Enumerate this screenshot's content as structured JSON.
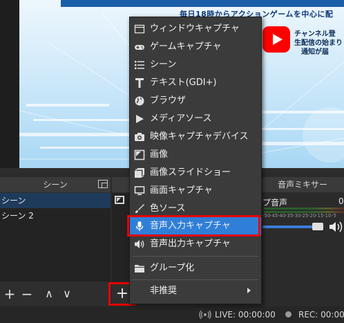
{
  "preview": {
    "subtitle": "毎日18時からアクションゲームを中心に配",
    "promo_lines": [
      "チャンネル登",
      "生配信の始まり",
      "通知が届"
    ],
    "colors": {
      "youtube": "#ff0000",
      "sky": "#cfe9fa"
    }
  },
  "scenes": {
    "title": "シーン",
    "items": [
      "シーン",
      "シーン 2"
    ],
    "selected_index": 0,
    "toolbar": {
      "add": "+",
      "remove": "−",
      "up": "∧",
      "down": "∨"
    }
  },
  "sources": {
    "add_button": "+"
  },
  "mixer": {
    "title": "音声ミキサー",
    "track_name": "プ音声",
    "db_value": "0",
    "scale": [
      "-50",
      "-45",
      "-40",
      "-35",
      "-30",
      "-25",
      "-20",
      "-15",
      "-10",
      "-5"
    ],
    "volume_level": 0.95
  },
  "statusbar": {
    "live": "LIVE: 00:00:00",
    "rec": "REC: 00:00:"
  },
  "context_menu": {
    "items": [
      {
        "label": "ウィンドウキャプチャ",
        "icon": "window-icon"
      },
      {
        "label": "ゲームキャプチャ",
        "icon": "gamepad-icon"
      },
      {
        "label": "シーン",
        "icon": "list-icon"
      },
      {
        "label": "テキスト(GDI+)",
        "icon": "text-icon"
      },
      {
        "label": "ブラウザ",
        "icon": "globe-icon"
      },
      {
        "label": "メディアソース",
        "icon": "play-icon"
      },
      {
        "label": "映像キャプチャデバイス",
        "icon": "camera-icon"
      },
      {
        "label": "画像",
        "icon": "image-icon"
      },
      {
        "label": "画像スライドショー",
        "icon": "slideshow-icon"
      },
      {
        "label": "画面キャプチャ",
        "icon": "monitor-icon"
      },
      {
        "label": "色ソース",
        "icon": "brush-icon"
      },
      {
        "label": "音声入力キャプチャ",
        "icon": "microphone-icon"
      },
      {
        "label": "音声出力キャプチャ",
        "icon": "speaker-icon"
      },
      {
        "label": "グループ化",
        "icon": "folder-icon"
      },
      {
        "label": "非推奨",
        "icon": "none"
      }
    ],
    "highlighted_index": 11,
    "highlight_color": "#2f7fd8",
    "callout_color": "#e60000"
  }
}
